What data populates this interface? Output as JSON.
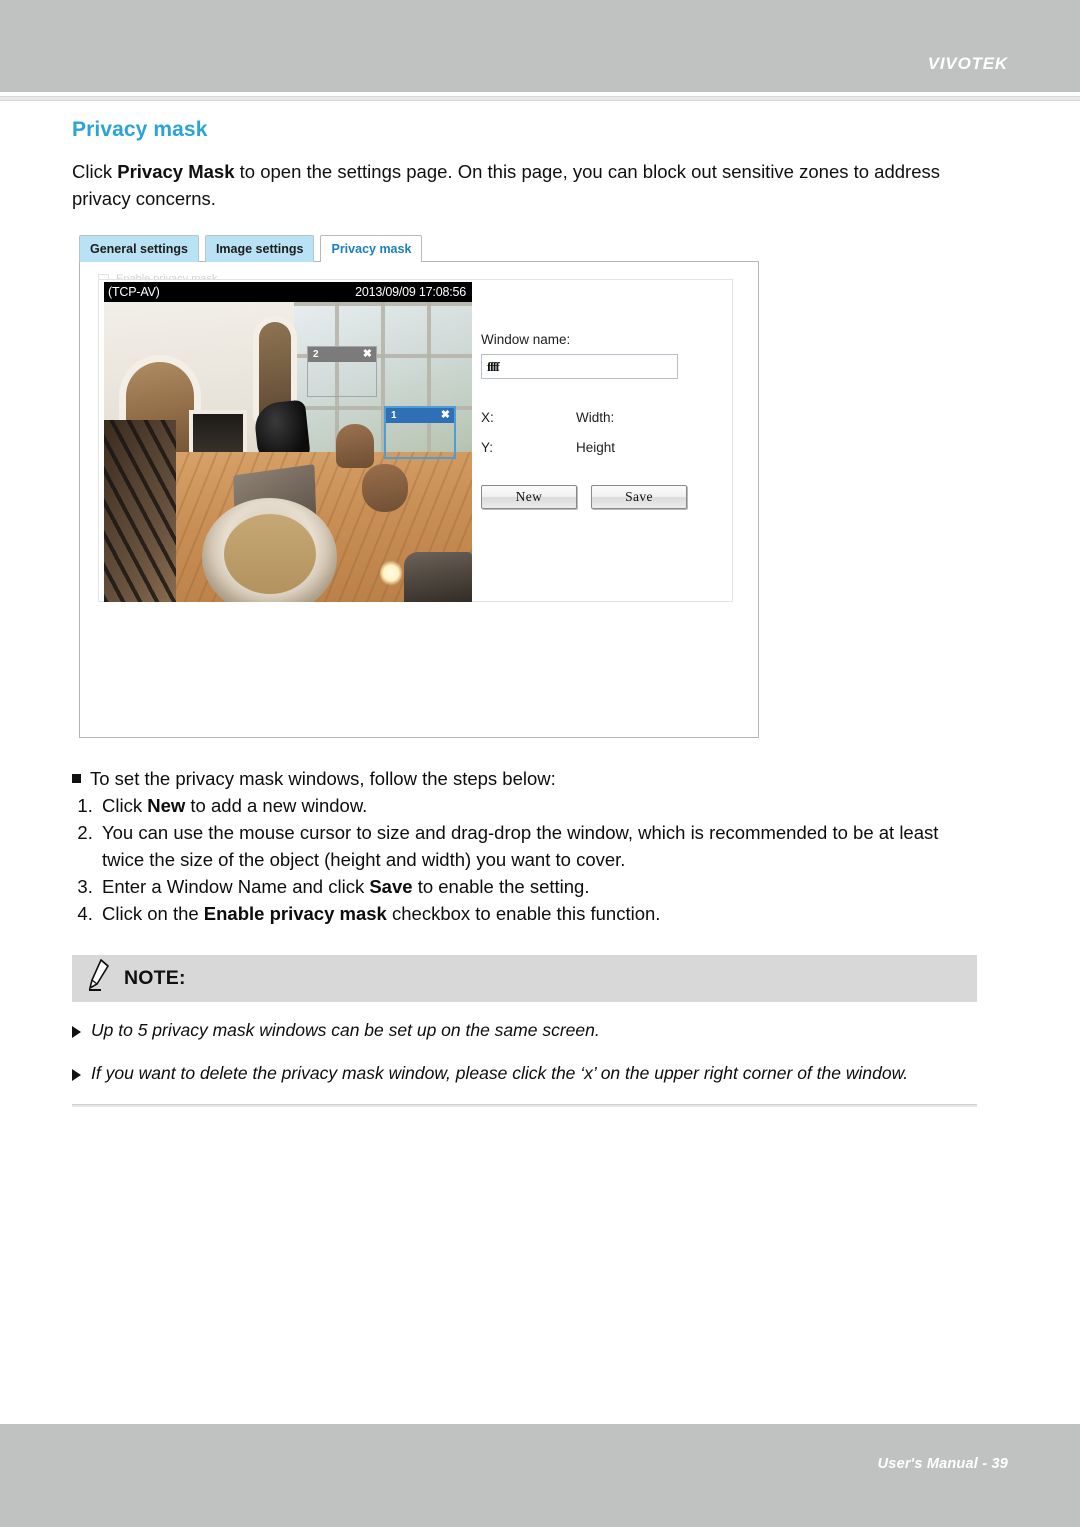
{
  "header": {
    "brand": "VIVOTEK"
  },
  "footer": {
    "text": "User's Manual - 39"
  },
  "page": {
    "section_title": "Privacy mask",
    "intro_prefix": "Click ",
    "intro_bold": "Privacy Mask",
    "intro_suffix": " to open the settings page. On this page, you can block out sensitive zones to address privacy concerns."
  },
  "ui": {
    "tabs": [
      {
        "label": "General settings",
        "active": false
      },
      {
        "label": "Image settings",
        "active": false
      },
      {
        "label": "Privacy mask",
        "active": true
      }
    ],
    "ghost_checkbox_label": "Enable privacy mask",
    "video": {
      "osd_left": "(TCP-AV)",
      "osd_right": "2013/09/09  17:08:56",
      "masks": [
        {
          "id": "2",
          "close": "✖",
          "state": "inactive"
        },
        {
          "id": "1",
          "close": "✖",
          "state": "active"
        }
      ]
    },
    "form": {
      "window_name_label": "Window name:",
      "window_name_value": "ffff",
      "window_name_placeholder": "",
      "x_label": "X:",
      "y_label": "Y:",
      "width_label": "Width:",
      "height_label": "Height",
      "new_button": "New",
      "save_button": "Save"
    }
  },
  "steps": {
    "lead": "To set the privacy mask windows, follow the steps below:",
    "items": [
      {
        "pre": "Click ",
        "bold": "New",
        "post": " to add a new window."
      },
      {
        "pre": "You can use the mouse cursor to size and drag-drop the window, which is recommended to be at least twice the size of the object (height and width) you want to cover.",
        "bold": "",
        "post": ""
      },
      {
        "pre": "Enter a Window Name and click ",
        "bold": "Save",
        "post": " to enable the setting."
      },
      {
        "pre": "Click on the ",
        "bold": "Enable privacy mask",
        "post": " checkbox to enable this function."
      }
    ]
  },
  "note": {
    "title": "NOTE:",
    "icon": "pencil-icon",
    "items": [
      "Up to 5 privacy mask windows can be set up on the same screen.",
      "If you want to delete the privacy mask window, please click the ‘x’ on the upper right corner of the window."
    ]
  },
  "colors": {
    "accent": "#2aa3d8",
    "tab_inactive_bg": "#b9e3f4",
    "mask_active": "#2e6fb5",
    "mask_inactive": "#7b7b7b",
    "header_bg": "#c0c1c1"
  }
}
